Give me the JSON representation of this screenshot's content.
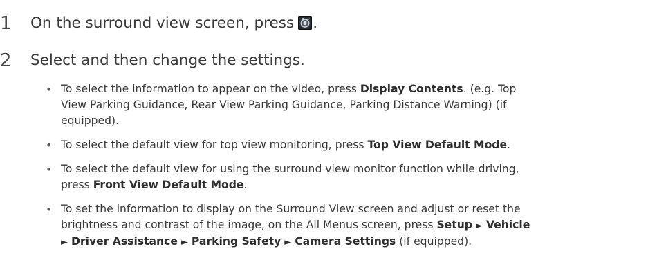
{
  "steps": [
    {
      "number": "1",
      "text_before": "On the surround view screen, press",
      "icon": "camera-settings-icon",
      "text_after": "."
    },
    {
      "number": "2",
      "text": "Select and then change the settings."
    }
  ],
  "bullets": [
    {
      "b1_text1": "To select the information to appear on the video, press ",
      "b1_bold1": "Display Contents",
      "b1_text2": ". (e.g. Top",
      "b1_line2": "View Parking Guidance, Rear View Parking Guidance, Parking Distance Warning) (if",
      "b1_line3": "equipped)."
    },
    {
      "b2_text1": "To select the default view for top view monitoring, press ",
      "b2_bold1": "Top View Default Mode",
      "b2_text2": "."
    },
    {
      "b3_line1": "To select the default view for using the surround view monitor function while driving,",
      "b3_text1": "press ",
      "b3_bold1": "Front View Default Mode",
      "b3_text2": "."
    },
    {
      "b4_line1": "To set the information to display on the Surround View screen and adjust or reset the",
      "b4_text1": "brightness and contrast of the image, on the All Menus screen, press ",
      "b4_bold_setup": "Setup",
      "b4_bold_vehicle": "Vehicle",
      "b4_bold_driver": "Driver Assistance",
      "b4_bold_parking": "Parking Safety",
      "b4_bold_camera": "Camera Settings",
      "b4_tail": " (if equipped).",
      "arrow": "►"
    }
  ],
  "bullet_char": "•"
}
